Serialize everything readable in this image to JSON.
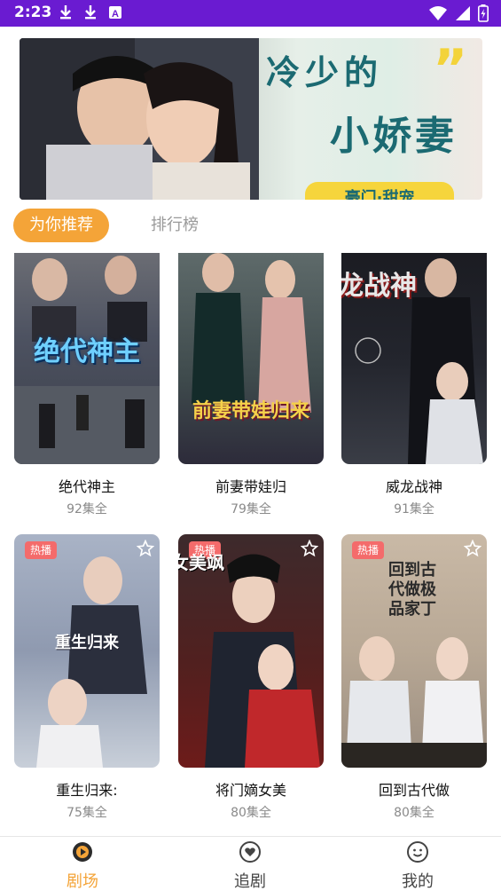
{
  "status_bar": {
    "time": "2:23",
    "left_icons": [
      "download-icon",
      "download-icon",
      "a-badge-icon"
    ],
    "right_icons": [
      "wifi-icon",
      "signal-icon",
      "battery-charging-icon"
    ]
  },
  "banner": {
    "title_line1": "冷少的",
    "title_line2": "小娇妻",
    "tag": "豪门·甜宠"
  },
  "tabs": [
    {
      "label": "为你推荐",
      "active": true
    },
    {
      "label": "排行榜",
      "active": false
    }
  ],
  "dramas": [
    {
      "name": "绝代神主",
      "episodes": "92集全",
      "poster_text": "绝代神主",
      "badge": ""
    },
    {
      "name": "前妻带娃归",
      "episodes": "79集全",
      "poster_text": "前妻带娃归来",
      "badge": ""
    },
    {
      "name": "威龙战神",
      "episodes": "91集全",
      "poster_text": "龙战神",
      "badge": ""
    },
    {
      "name": "重生归来:",
      "episodes": "75集全",
      "poster_text": "重生归来",
      "badge": "热播"
    },
    {
      "name": "将门嫡女美",
      "episodes": "80集全",
      "poster_text": "嫡女美飒",
      "badge": "热播"
    },
    {
      "name": "回到古代做",
      "episodes": "80集全",
      "poster_text": "回到古代做极品家丁",
      "badge": "热播"
    }
  ],
  "bottom_nav": [
    {
      "label": "剧场",
      "icon": "theater-play-icon",
      "active": true
    },
    {
      "label": "追剧",
      "icon": "heart-icon",
      "active": false
    },
    {
      "label": "我的",
      "icon": "smile-face-icon",
      "active": false
    }
  ],
  "colors": {
    "status_bar": "#6a1bd1",
    "accent_orange": "#f4a438",
    "hot_badge": "#f46b6b",
    "inactive_text": "#9a9a9a"
  }
}
